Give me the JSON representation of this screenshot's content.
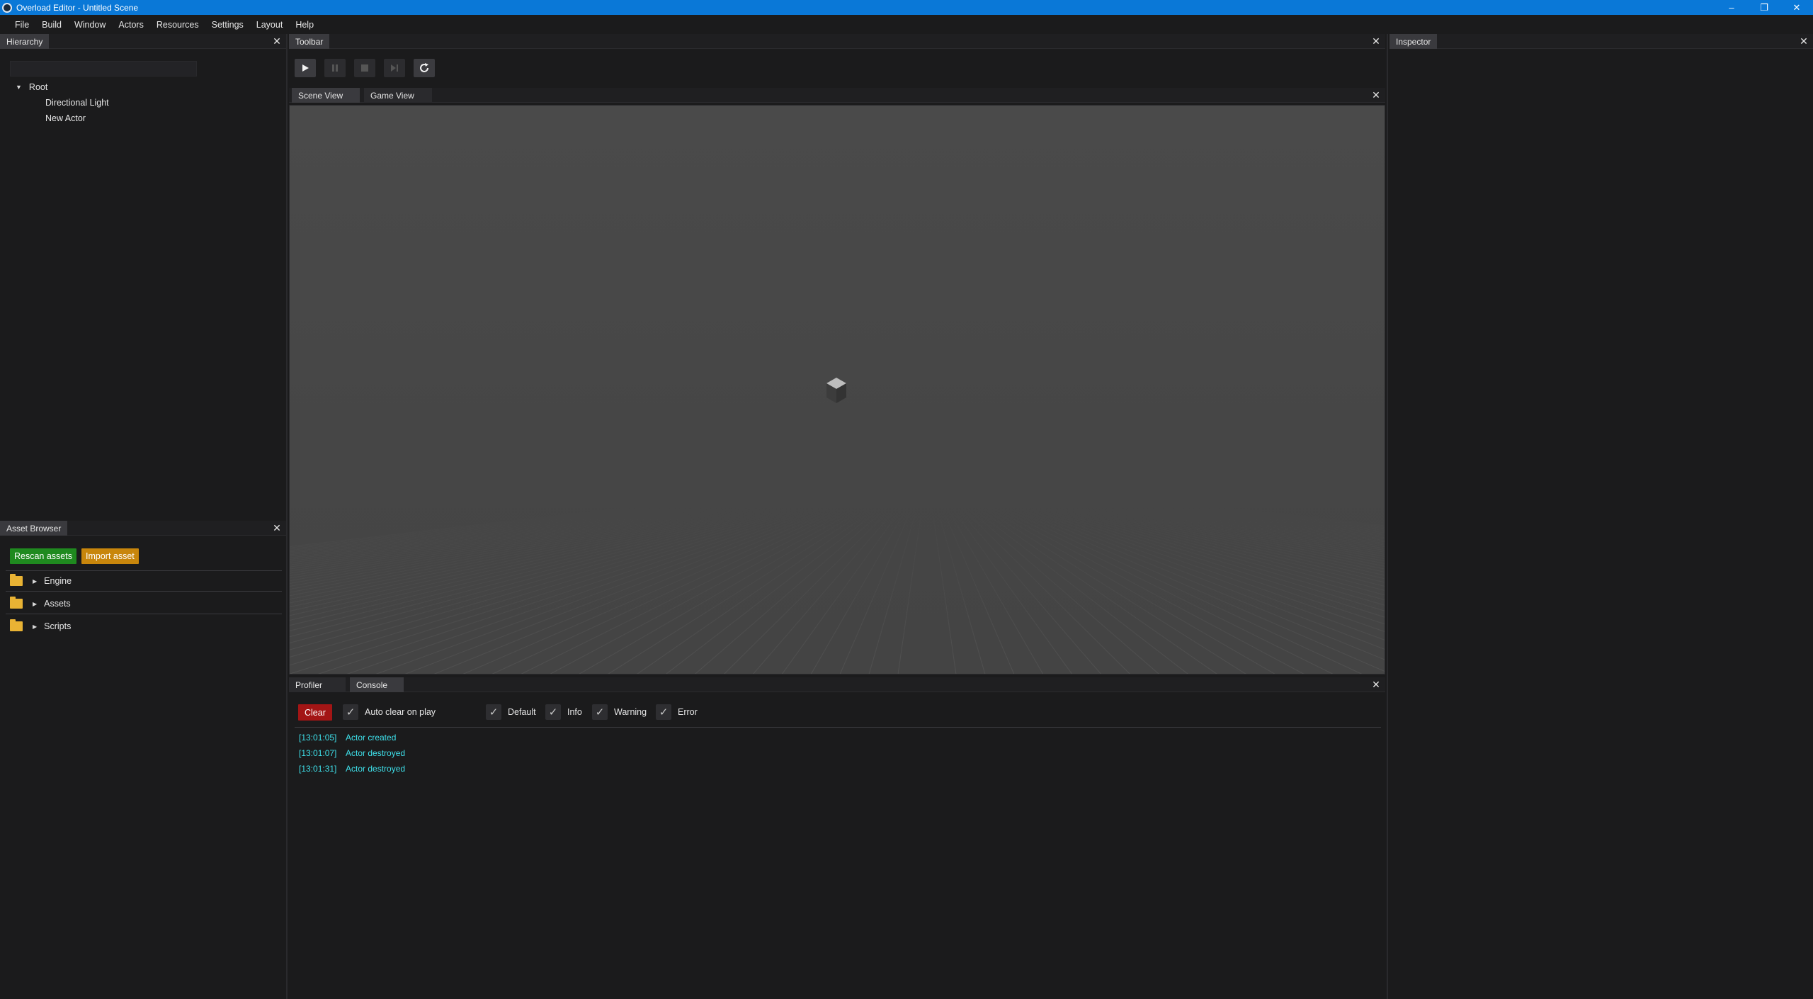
{
  "window": {
    "title": "Overload Editor - Untitled Scene",
    "controls": [
      "minimize-icon",
      "restore-icon",
      "close-icon"
    ],
    "accent": "#0a78d7"
  },
  "menu": [
    "File",
    "Build",
    "Window",
    "Actors",
    "Resources",
    "Settings",
    "Layout",
    "Help"
  ],
  "hierarchy": {
    "tab": "Hierarchy",
    "search_placeholder": "",
    "root": "Root",
    "children": [
      "Directional Light",
      "New Actor"
    ]
  },
  "toolbar": {
    "tab": "Toolbar",
    "buttons": [
      "play-icon",
      "pause-icon",
      "stop-icon",
      "next-frame-icon",
      "refresh-icon"
    ]
  },
  "inspector": {
    "tab": "Inspector"
  },
  "views": {
    "tabs": [
      "Scene View",
      "Game View"
    ],
    "active": "Scene View"
  },
  "asset_browser": {
    "tab": "Asset Browser",
    "rescan": "Rescan assets",
    "import": "Import asset",
    "folders": [
      "Engine",
      "Assets",
      "Scripts"
    ],
    "colors": {
      "rescan": "#1f8a1f",
      "import": "#c8860c",
      "folder": "#e9b334"
    }
  },
  "bottom": {
    "tabs": [
      "Profiler",
      "Console"
    ],
    "active": "Console"
  },
  "console": {
    "clear": "Clear",
    "clear_color": "#a31515",
    "filters": [
      {
        "label": "Auto clear on play",
        "checked": true
      },
      {
        "label": "Default",
        "checked": true
      },
      {
        "label": "Info",
        "checked": true
      },
      {
        "label": "Warning",
        "checked": true
      },
      {
        "label": "Error",
        "checked": true
      }
    ],
    "logs": [
      {
        "time": "[13:01:05]",
        "msg": "Actor created"
      },
      {
        "time": "[13:01:07]",
        "msg": "Actor destroyed"
      },
      {
        "time": "[13:01:31]",
        "msg": "Actor destroyed"
      }
    ],
    "log_color": "#3ee0ea"
  }
}
